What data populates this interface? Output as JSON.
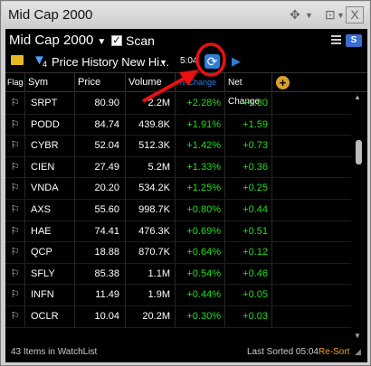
{
  "window": {
    "title": "Mid Cap 2000"
  },
  "toolbar": {
    "watchlist_name": "Mid Cap 2000",
    "scan_label": "Scan",
    "scan_checked": "✓",
    "filter_badge": "4",
    "source_label": "Price History New Hi...",
    "time_label": "5:04",
    "s_label": "S"
  },
  "columns": [
    "Flag",
    "Sym",
    "Price",
    "Volume",
    "% Change",
    "Net Change"
  ],
  "rows": [
    {
      "sym": "SRPT",
      "price": "80.90",
      "volume": "2.2M",
      "change": "+2.28%",
      "net": "+1.80"
    },
    {
      "sym": "PODD",
      "price": "84.74",
      "volume": "439.8K",
      "change": "+1.91%",
      "net": "+1.59"
    },
    {
      "sym": "CYBR",
      "price": "52.04",
      "volume": "512.3K",
      "change": "+1.42%",
      "net": "+0.73"
    },
    {
      "sym": "CIEN",
      "price": "27.49",
      "volume": "5.2M",
      "change": "+1.33%",
      "net": "+0.36"
    },
    {
      "sym": "VNDA",
      "price": "20.20",
      "volume": "534.2K",
      "change": "+1.25%",
      "net": "+0.25"
    },
    {
      "sym": "AXS",
      "price": "55.60",
      "volume": "998.7K",
      "change": "+0.80%",
      "net": "+0.44"
    },
    {
      "sym": "HAE",
      "price": "74.41",
      "volume": "476.3K",
      "change": "+0.69%",
      "net": "+0.51"
    },
    {
      "sym": "QCP",
      "price": "18.88",
      "volume": "870.7K",
      "change": "+0.64%",
      "net": "+0.12"
    },
    {
      "sym": "SFLY",
      "price": "85.38",
      "volume": "1.1M",
      "change": "+0.54%",
      "net": "+0.46"
    },
    {
      "sym": "INFN",
      "price": "11.49",
      "volume": "1.9M",
      "change": "+0.44%",
      "net": "+0.05"
    },
    {
      "sym": "OCLR",
      "price": "10.04",
      "volume": "20.2M",
      "change": "+0.30%",
      "net": "+0.03"
    }
  ],
  "footer": {
    "count_label": "43 Items in WatchList",
    "sorted_label": "Last Sorted 05:04",
    "resort_label": "Re-Sort"
  },
  "colors": {
    "positive": "#22dd22",
    "accent": "#2c7fd8",
    "annotation": "#e81010",
    "resort": "#f0a020"
  },
  "icons": [
    "move-icon",
    "pin-icon",
    "close-icon",
    "menu-icon",
    "folder-icon",
    "filter-icon",
    "refresh-icon",
    "play-icon",
    "add-column-icon",
    "flag-icon"
  ]
}
